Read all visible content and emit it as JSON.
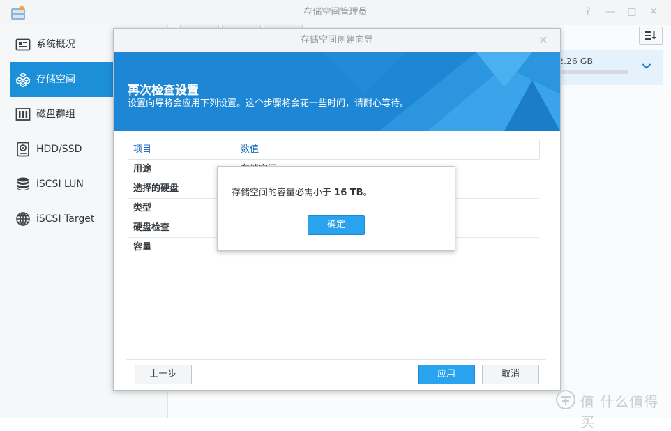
{
  "app": {
    "title": "存储空间管理员",
    "titlebar_buttons": {
      "help": "?",
      "minimize": "—",
      "maximize": "□",
      "close": "✕"
    }
  },
  "sidebar": {
    "items": [
      {
        "label": "系统概况",
        "icon": "overview-icon",
        "active": false
      },
      {
        "label": "存储空间",
        "icon": "storage-icon",
        "active": true
      },
      {
        "label": "磁盘群组",
        "icon": "disk-group-icon",
        "active": false
      },
      {
        "label": "HDD/SSD",
        "icon": "hdd-icon",
        "active": false
      },
      {
        "label": "iSCSI LUN",
        "icon": "database-icon",
        "active": false
      },
      {
        "label": "iSCSI Target",
        "icon": "globe-icon",
        "active": false
      }
    ]
  },
  "volume": {
    "size": "2.26 GB"
  },
  "wizard": {
    "title": "存储空间创建向导",
    "heading": "再次检查设置",
    "subtitle": "设置向导将会应用下列设置。这个步骤将会花一些时间，请耐心等待。",
    "table": {
      "headers": [
        "项目",
        "数值"
      ],
      "rows": [
        {
          "key": "用途",
          "value": "存储空间"
        },
        {
          "key": "选择的硬盘",
          "value": ""
        },
        {
          "key": "类型",
          "value": ""
        },
        {
          "key": "硬盘检查",
          "value": ""
        },
        {
          "key": "容量",
          "value": ""
        }
      ]
    },
    "buttons": {
      "back": "上一步",
      "apply": "应用",
      "cancel": "取消"
    }
  },
  "alert": {
    "message_prefix": "存储空间的容量必需小于",
    "message_value": "16 TB",
    "message_suffix": "。",
    "ok": "确定"
  },
  "watermark": {
    "text": "值 什么值得买"
  },
  "colors": {
    "accent": "#1b8fd8",
    "button_blue": "#2aa3ee"
  }
}
